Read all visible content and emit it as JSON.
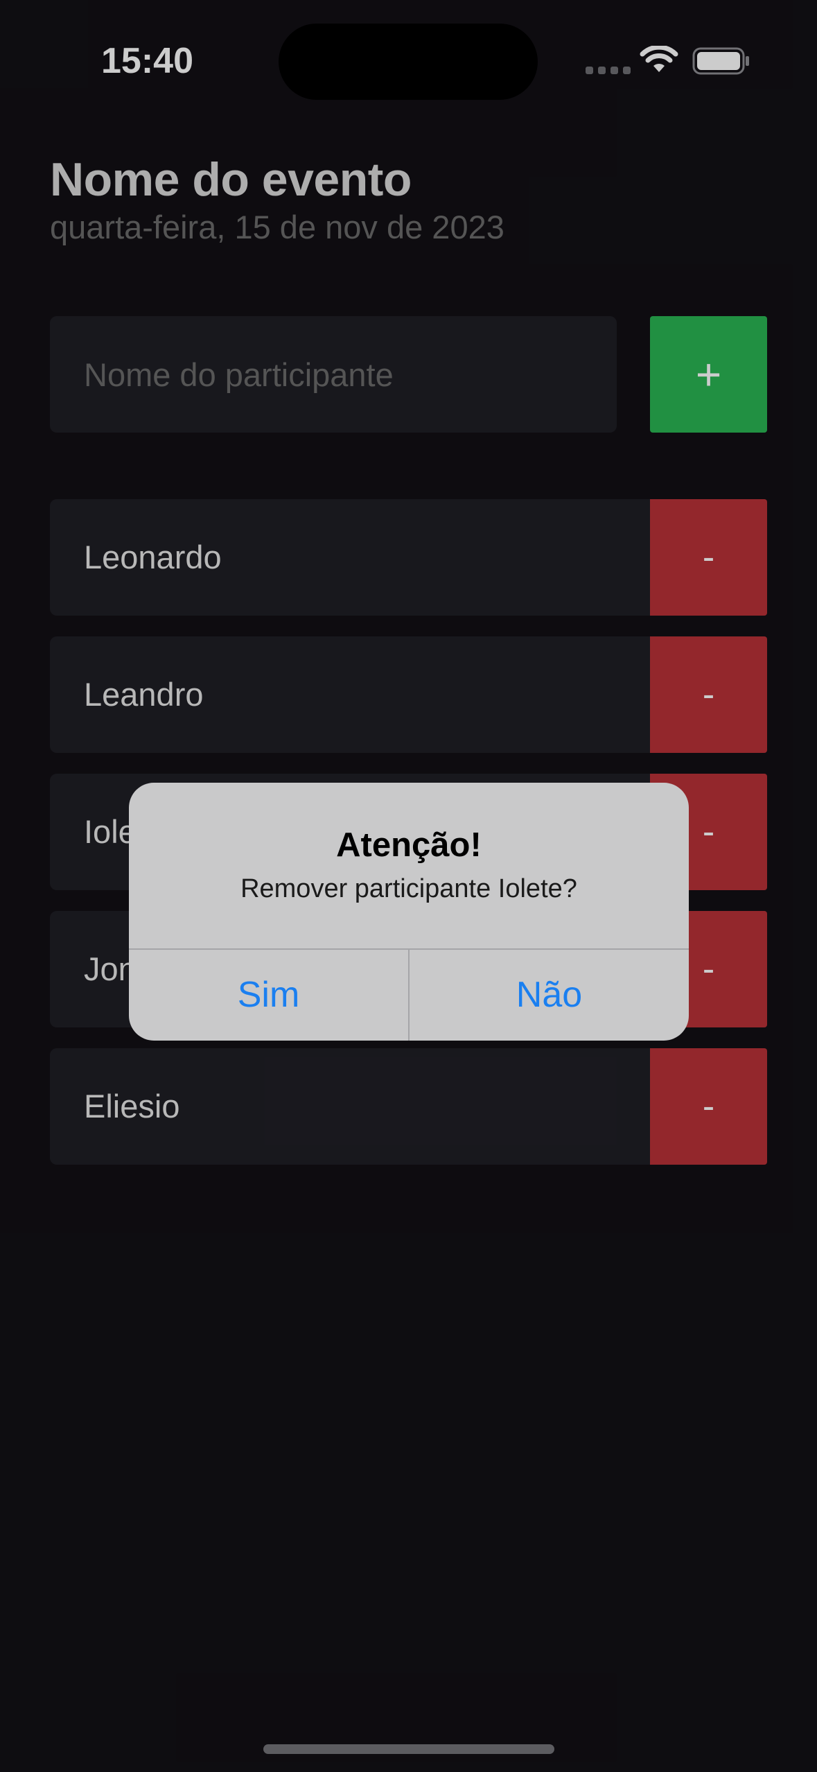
{
  "status_bar": {
    "time": "15:40"
  },
  "header": {
    "title": "Nome do evento",
    "date": "quarta-feira, 15 de nov de 2023"
  },
  "form": {
    "placeholder": "Nome do participante",
    "add_label": "+"
  },
  "participants": [
    {
      "name": "Leonardo",
      "remove_label": "-"
    },
    {
      "name": "Leandro",
      "remove_label": "-"
    },
    {
      "name": "Iolete",
      "remove_label": "-"
    },
    {
      "name": "Jonas",
      "remove_label": "-"
    },
    {
      "name": "Eliesio",
      "remove_label": "-"
    }
  ],
  "alert": {
    "title": "Atenção!",
    "message": "Remover participante Iolete?",
    "confirm_label": "Sim",
    "cancel_label": "Não"
  },
  "colors": {
    "background": "#121015",
    "card": "#1f1e25",
    "add": "#2ab553",
    "remove": "#b83138",
    "alert_button": "#1a7ff0"
  },
  "icons": {
    "wifi": "wifi-icon",
    "battery": "battery-icon",
    "signal": "cellular-signal-icon"
  }
}
